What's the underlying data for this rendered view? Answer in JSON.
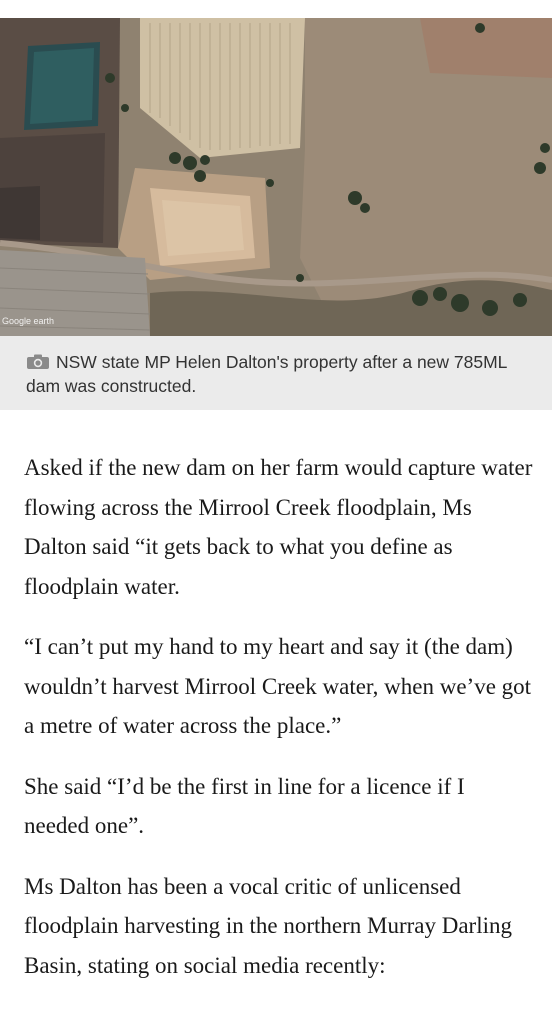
{
  "image": {
    "watermark": "Google earth",
    "alt": "Aerial satellite photo of farmland with a dam"
  },
  "caption": {
    "icon": "camera-icon",
    "text": "NSW state MP Helen Dalton's property after a new 785ML dam was constructed."
  },
  "article": {
    "paragraphs": [
      "Asked if the new dam on her farm would capture water flowing across the Mirrool Creek floodplain, Ms Dalton said “it gets back to what you define as floodplain water.",
      "“I can’t put my hand to my heart and say it (the dam) wouldn’t harvest Mirrool Creek water, when we’ve got a metre of water across the place.”",
      "She said “I’d be the first in line for a licence if I needed one”.",
      "Ms Dalton has been a vocal critic of unlicensed floodplain harvesting in the northern Murray Darling Basin, stating on social media recently:"
    ]
  },
  "colors": {
    "caption_bg": "#ebebeb",
    "text": "#1a1a1a"
  }
}
